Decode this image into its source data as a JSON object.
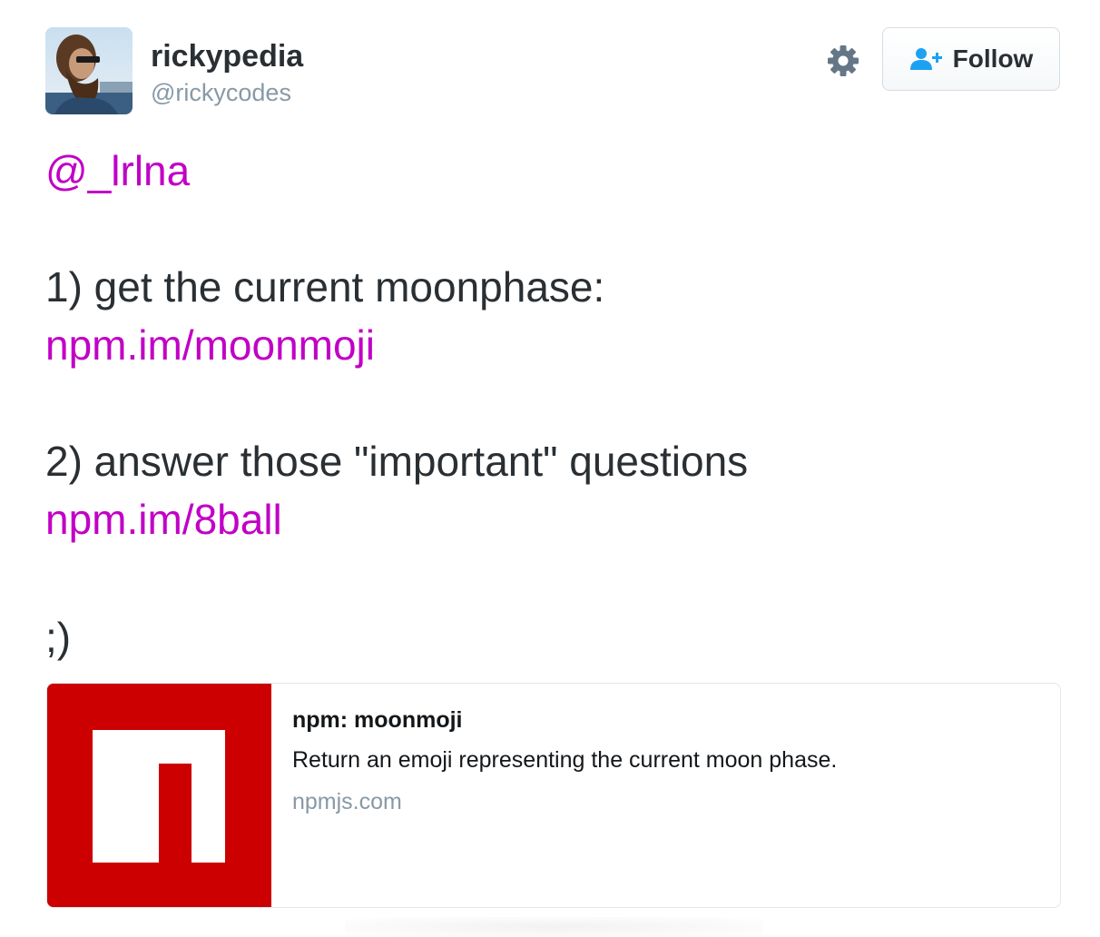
{
  "author": {
    "display_name": "rickypedia",
    "handle": "@rickycodes",
    "avatar_icon": "user-avatar-photo"
  },
  "actions": {
    "settings_icon": "gear-icon",
    "follow_icon": "add-user-icon",
    "follow_label": "Follow"
  },
  "tweet": {
    "mention": "@_lrlna",
    "line1": "1) get the current moonphase:",
    "link1": "npm.im/moonmoji",
    "line2": "2) answer those \"important\" questions",
    "link2": "npm.im/8ball",
    "closing": ";)"
  },
  "card": {
    "image_icon": "npm-logo",
    "title": "npm: moonmoji",
    "description": "Return an emoji representing the current moon phase.",
    "domain": "npmjs.com"
  },
  "colors": {
    "link": "#c100c6",
    "text": "#292f33",
    "muted": "#8899a6",
    "npm_red": "#cc0000",
    "follow_icon": "#1da1f2"
  }
}
